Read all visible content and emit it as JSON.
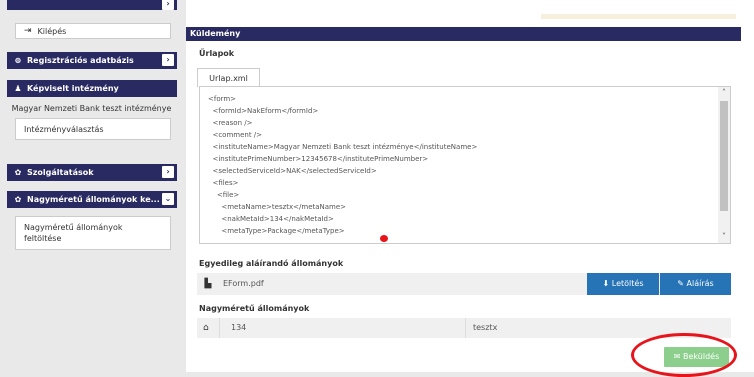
{
  "sidebar": {
    "logout_label": "Kilépés",
    "registry_label": "Regisztrációs adatbázis",
    "represented_label": "Képviselt intézmény",
    "institute_name": "Magyar Nemzeti Bank teszt intézménye",
    "institute_select_label": "Intézményválasztás",
    "services_label": "Szolgáltatások",
    "large_files_label": "Nagyméretű állományok ke...",
    "upload_label_line1": "Nagyméretű állományok",
    "upload_label_line2": "feltöltése"
  },
  "main": {
    "section_title": "Küldemény",
    "forms_label": "Űrlapok",
    "tab_label": "Urlap.xml",
    "xml_lines": [
      "<form>",
      "  <formId>NakEform</formId>",
      "  <reason />",
      "  <comment />",
      "  <instituteName>Magyar Nemzeti Bank teszt intézménye</instituteName>",
      "  <institutePrimeNumber>12345678</institutePrimeNumber>",
      "  <selectedServiceId>NAK</selectedServiceId>",
      "  <files>",
      "    <file>",
      "      <metaName>tesztx</metaName>",
      "      <nakMetaId>134</nakMetaId>",
      "      <metaType>Package</metaType>"
    ],
    "sign_files_label": "Egyedileg aláírandó állományok",
    "sign_file_name": "EForm.pdf",
    "download_label": "Letöltés",
    "sign_label": "Aláírás",
    "large_files_label": "Nagyméretű állományok",
    "large_file_id": "134",
    "large_file_name": "tesztx",
    "submit_label": "Beküldés"
  },
  "colors": {
    "header_navy": "#2a2a63",
    "button_blue": "#2673b6",
    "submit_green": "#8ccf8c",
    "annotation_red": "#e8141b"
  },
  "icons": [
    "logout-icon",
    "database-icon",
    "user-icon",
    "gear-icon",
    "chevron-right-icon",
    "chevron-down-icon",
    "file-icon",
    "download-icon",
    "pen-icon",
    "package-icon",
    "send-icon"
  ]
}
